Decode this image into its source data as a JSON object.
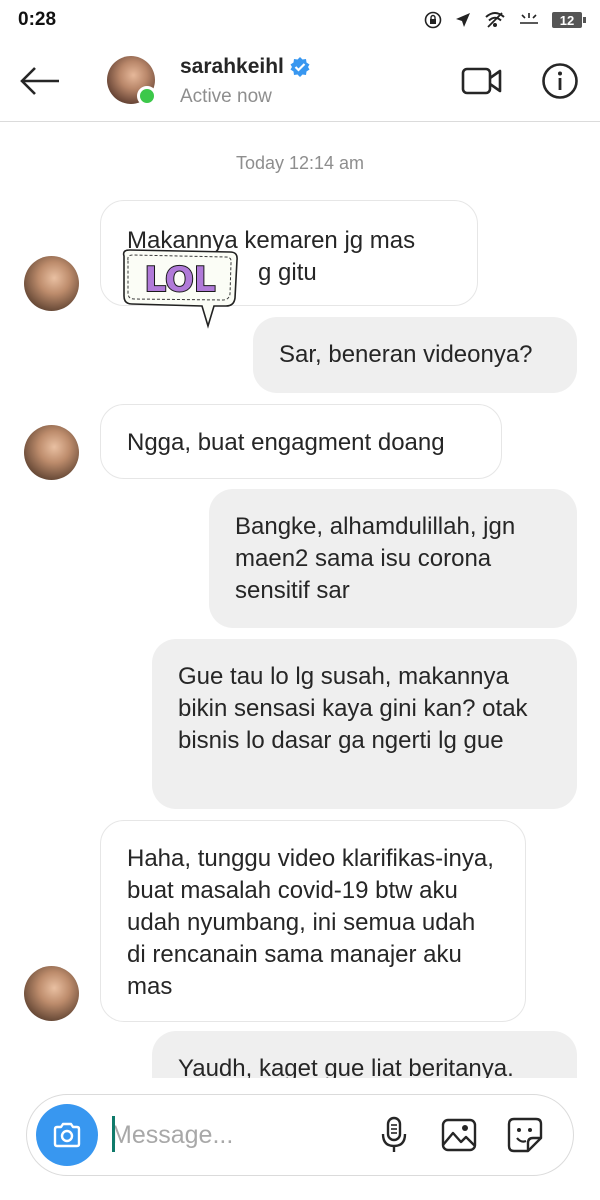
{
  "status_bar": {
    "time": "0:28",
    "battery": "12"
  },
  "header": {
    "username": "sarahkeihl",
    "verified": true,
    "status": "Active now",
    "icons": [
      "back-arrow-icon",
      "video-call-icon",
      "info-icon",
      "verified-badge-icon"
    ]
  },
  "thread": {
    "timestamp": "Today 12:14 am",
    "messages": [
      {
        "from": "them",
        "text": "Makannya kemaren jg mas ...ng gitu"
      },
      {
        "from": "me",
        "text": "Sar, beneran videonya?"
      },
      {
        "from": "them",
        "text": "Ngga, buat engagment doang"
      },
      {
        "from": "me",
        "text": "Bangke, alhamdulillah, jgn maen2 sama isu corona sensitif sar"
      },
      {
        "from": "me",
        "text": "Gue tau lo lg susah, makannya bikin sensasi kaya gini kan? otak bisnis lo dasar ga ngerti lg gue"
      },
      {
        "from": "them",
        "text": "Haha, tunggu video klarifikas-inya, buat masalah covid-19 btw aku udah nyumbang, ini semua udah di rencanain sama manajer aku mas"
      },
      {
        "from": "me",
        "text": "Yaudh, kaget gue liat beritanya."
      }
    ],
    "msg1_line1": "Makannya kemaren jg mas",
    "msg1_line2": "g gitu",
    "sticker_text": "LOL"
  },
  "composer": {
    "placeholder": "Message...",
    "icons": [
      "camera-icon",
      "microphone-icon",
      "gallery-icon",
      "sticker-icon"
    ]
  },
  "colors": {
    "online": "#3cc84a",
    "verified": "#3897f0",
    "camera_button": "#3897f0",
    "outgoing_bubble": "#efefef"
  }
}
